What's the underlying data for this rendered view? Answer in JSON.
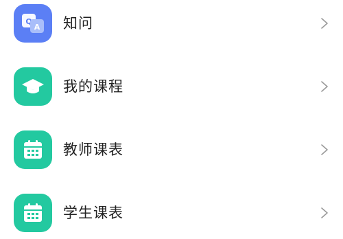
{
  "menu": {
    "items": [
      {
        "label": "知问",
        "icon": "qa-icon",
        "color": "#5B7FF5",
        "variant": "qa"
      },
      {
        "label": "我的课程",
        "icon": "graduation-cap-icon",
        "color": "#23C9A0",
        "variant": "cap"
      },
      {
        "label": "教师课表",
        "icon": "calendar-icon",
        "color": "#23C9A0",
        "variant": "calendar"
      },
      {
        "label": "学生课表",
        "icon": "calendar-icon",
        "color": "#23C9A0",
        "variant": "calendar"
      }
    ]
  }
}
